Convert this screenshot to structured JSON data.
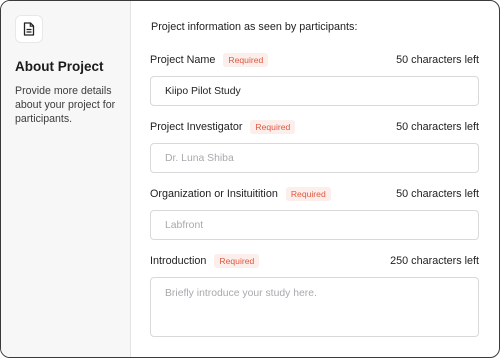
{
  "sidebar": {
    "icon": "document-icon",
    "title": "About Project",
    "description": "Provide more details about your project for participants."
  },
  "main": {
    "intro": "Project information as seen by participants:",
    "required_label": "Required",
    "fields": [
      {
        "label": "Project Name",
        "limit": "50 characters left",
        "value": "Kiipo Pilot Study",
        "placeholder": ""
      },
      {
        "label": "Project Investigator",
        "limit": "50 characters left",
        "value": "",
        "placeholder": "Dr. Luna Shiba"
      },
      {
        "label": "Organization or Insituitition",
        "limit": "50 characters left",
        "value": "",
        "placeholder": "Labfront"
      },
      {
        "label": "Introduction",
        "limit": "250 characters left",
        "value": "",
        "placeholder": "Briefly introduce your study here."
      }
    ]
  },
  "colors": {
    "required_text": "#e0573f",
    "required_bg": "#fbeeeb",
    "sidebar_bg": "#f7f7f8"
  }
}
